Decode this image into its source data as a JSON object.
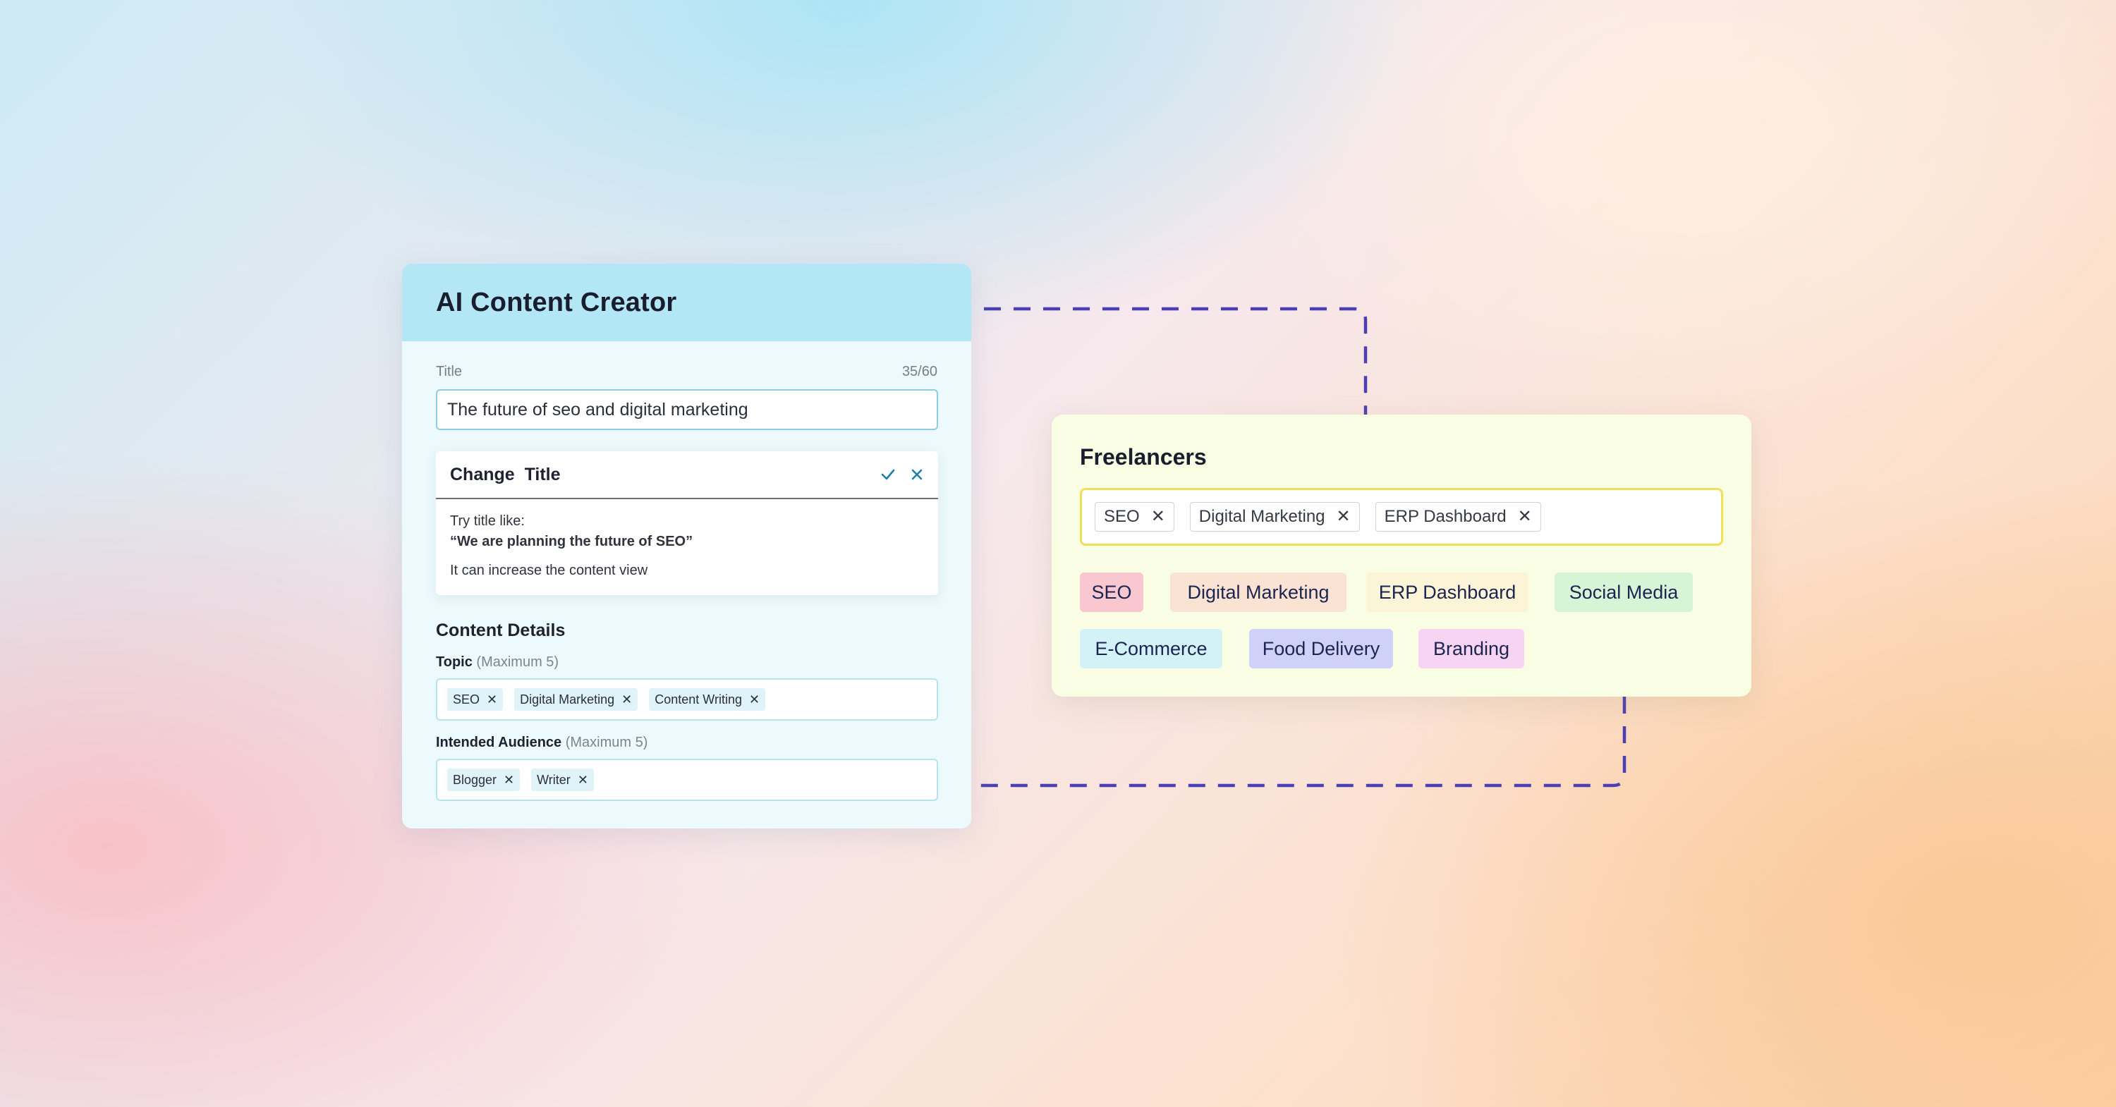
{
  "colors": {
    "connector": "#4b3fb3",
    "ai_header": "#b4e7f6",
    "freelancer_border": "#f2df58",
    "icon_accent": "#1f7fa8"
  },
  "ai_card": {
    "title": "AI Content Creator",
    "title_label": "Title",
    "char_count": "35/60",
    "title_value": "The future of seo and digital marketing",
    "suggestion": {
      "heading": "Change  Title",
      "confirm_icon": "check-icon",
      "dismiss_icon": "close-icon",
      "line1": "Try title like:",
      "line2": "“We are planning the future of SEO”",
      "line3": "It can increase the content view"
    },
    "content_details": {
      "heading": "Content Details",
      "topic_label": "Topic",
      "topic_hint": "(Maximum 5)",
      "topics": [
        "SEO",
        "Digital Marketing",
        "Content Writing"
      ],
      "audience_label": "Intended Audience",
      "audience_hint": "(Maximum 5)",
      "audiences": [
        "Blogger",
        "Writer"
      ]
    }
  },
  "freelancers_card": {
    "title": "Freelancers",
    "selected": [
      "SEO",
      "Digital Marketing",
      "ERP Dashboard"
    ],
    "options": [
      {
        "label": "SEO",
        "color": "#f8c7cf"
      },
      {
        "label": "Digital Marketing",
        "color": "#fbe3d4"
      },
      {
        "label": "ERP Dashboard",
        "color": "#fcf4d6"
      },
      {
        "label": "Social Media",
        "color": "#d6f5d6"
      },
      {
        "label": "E-Commerce",
        "color": "#d3f2f7"
      },
      {
        "label": "Food Delivery",
        "color": "#cfd2f6"
      },
      {
        "label": "Branding",
        "color": "#f7d4f2"
      }
    ]
  }
}
